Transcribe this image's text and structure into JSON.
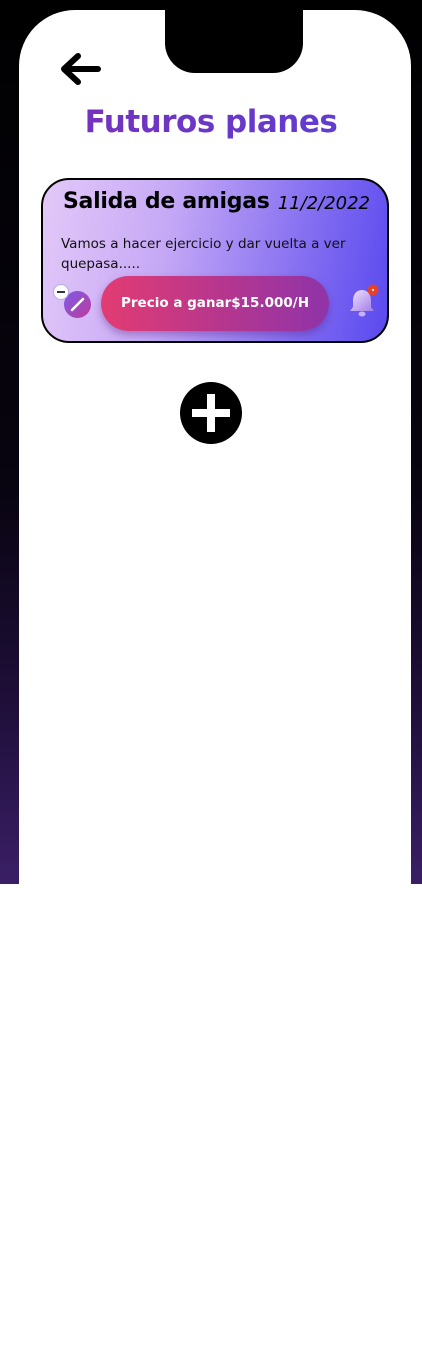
{
  "app": {
    "title": "Futuros planes"
  },
  "header": {
    "back_icon": "arrow-left-icon",
    "title": "Futuros planes",
    "title_gradient": [
      "#7b2fb8",
      "#5a3fd6"
    ]
  },
  "plans": [
    {
      "title": "Salida de amigas",
      "date": "11/2/2022",
      "description": "Vamos a hacer ejercicio y dar vuelta a ver quepasa.....",
      "price_label": "Precio a ganar$15.000/H",
      "remove_icon": "minus-circle-icon",
      "edit_icon": "pencil-icon",
      "notification_icon": "bell-icon",
      "colors": {
        "card_gradient": [
          "#e3c8f8",
          "#5a49ef"
        ],
        "button_gradient": [
          "#e23c72",
          "#8f34a8"
        ],
        "badge": "#e2412a"
      }
    }
  ],
  "actions": {
    "add_icon": "plus-circle-icon"
  }
}
